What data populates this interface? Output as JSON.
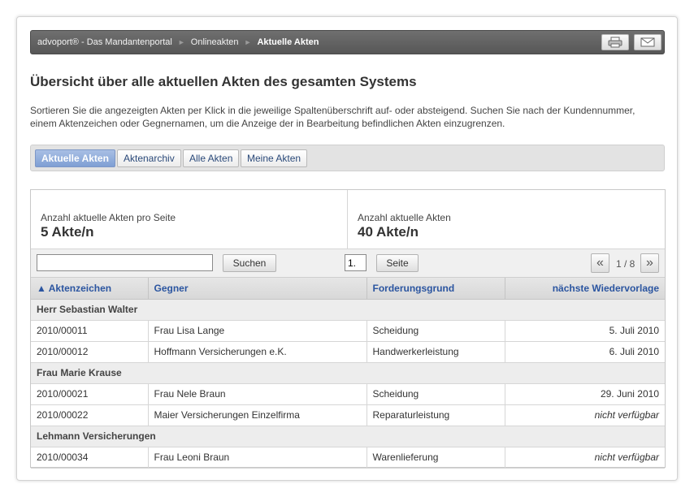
{
  "breadcrumb": [
    {
      "label": "advoport® - Das Mandantenportal"
    },
    {
      "label": "Onlineakten"
    },
    {
      "label": "Aktuelle Akten"
    }
  ],
  "toolbar": {
    "print_icon": "printer-icon",
    "mail_icon": "envelope-icon"
  },
  "page": {
    "title": "Übersicht über alle aktuellen Akten des gesamten Systems",
    "intro": "Sortieren Sie die angezeigten Akten per Klick in die jeweilige Spaltenüberschrift auf- oder absteigend. Suchen Sie nach der Kundennummer, einem Aktenzeichen oder Gegnernamen, um die Anzeige der in Bearbeitung befindlichen Akten einzugrenzen."
  },
  "tabs": [
    {
      "label": "Aktuelle Akten",
      "active": true
    },
    {
      "label": "Aktenarchiv",
      "active": false
    },
    {
      "label": "Alle Akten",
      "active": false
    },
    {
      "label": "Meine Akten",
      "active": false
    }
  ],
  "stats": {
    "per_page_label": "Anzahl aktuelle Akten pro Seite",
    "per_page_value": "5 Akte/n",
    "total_label": "Anzahl aktuelle Akten",
    "total_value": "40 Akte/n"
  },
  "search": {
    "value": "",
    "button": "Suchen",
    "page_value": "1.",
    "page_button": "Seite",
    "pager_prev": "«",
    "pager_next": "»",
    "pager_count": "1 / 8"
  },
  "table": {
    "columns": [
      "▲ Aktenzeichen",
      "Gegner",
      "Forderungsgrund",
      "nächste Wiedervorlage"
    ],
    "groups": [
      {
        "client": "Herr Sebastian Walter",
        "rows": [
          {
            "az": "2010/00011",
            "gegner": "Frau Lisa Lange",
            "grund": "Scheidung",
            "wv": "5. Juli 2010"
          },
          {
            "az": "2010/00012",
            "gegner": "Hoffmann Versicherungen e.K.",
            "grund": "Handwerkerleistung",
            "wv": "6. Juli 2010"
          }
        ]
      },
      {
        "client": "Frau Marie Krause",
        "rows": [
          {
            "az": "2010/00021",
            "gegner": "Frau Nele Braun",
            "grund": "Scheidung",
            "wv": "29. Juni 2010"
          },
          {
            "az": "2010/00022",
            "gegner": "Maier Versicherungen Einzelfirma",
            "grund": "Reparaturleistung",
            "wv": "nicht verfügbar"
          }
        ]
      },
      {
        "client": "Lehmann Versicherungen",
        "rows": [
          {
            "az": "2010/00034",
            "gegner": "Frau Leoni Braun",
            "grund": "Warenlieferung",
            "wv": "nicht verfügbar"
          }
        ]
      }
    ]
  }
}
